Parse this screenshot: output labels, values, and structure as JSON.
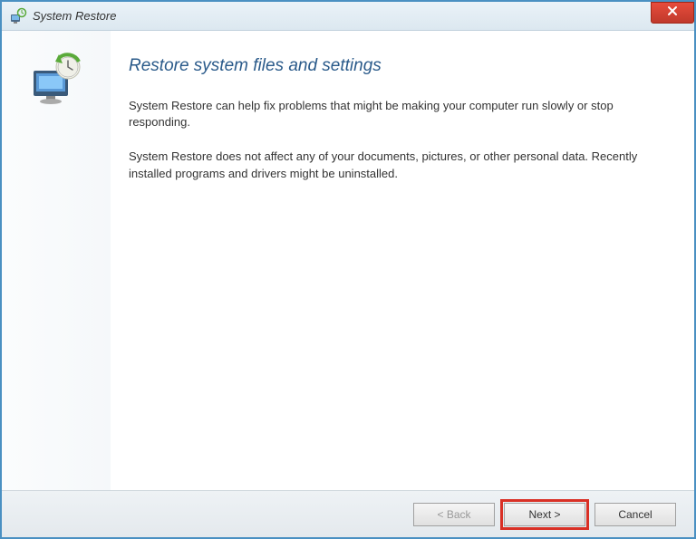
{
  "titlebar": {
    "title": "System Restore"
  },
  "content": {
    "heading": "Restore system files and settings",
    "paragraph1": "System Restore can help fix problems that might be making your computer run slowly or stop responding.",
    "paragraph2": "System Restore does not affect any of your documents, pictures, or other personal data. Recently installed programs and drivers might be uninstalled."
  },
  "buttons": {
    "back": "< Back",
    "next": "Next >",
    "cancel": "Cancel"
  }
}
